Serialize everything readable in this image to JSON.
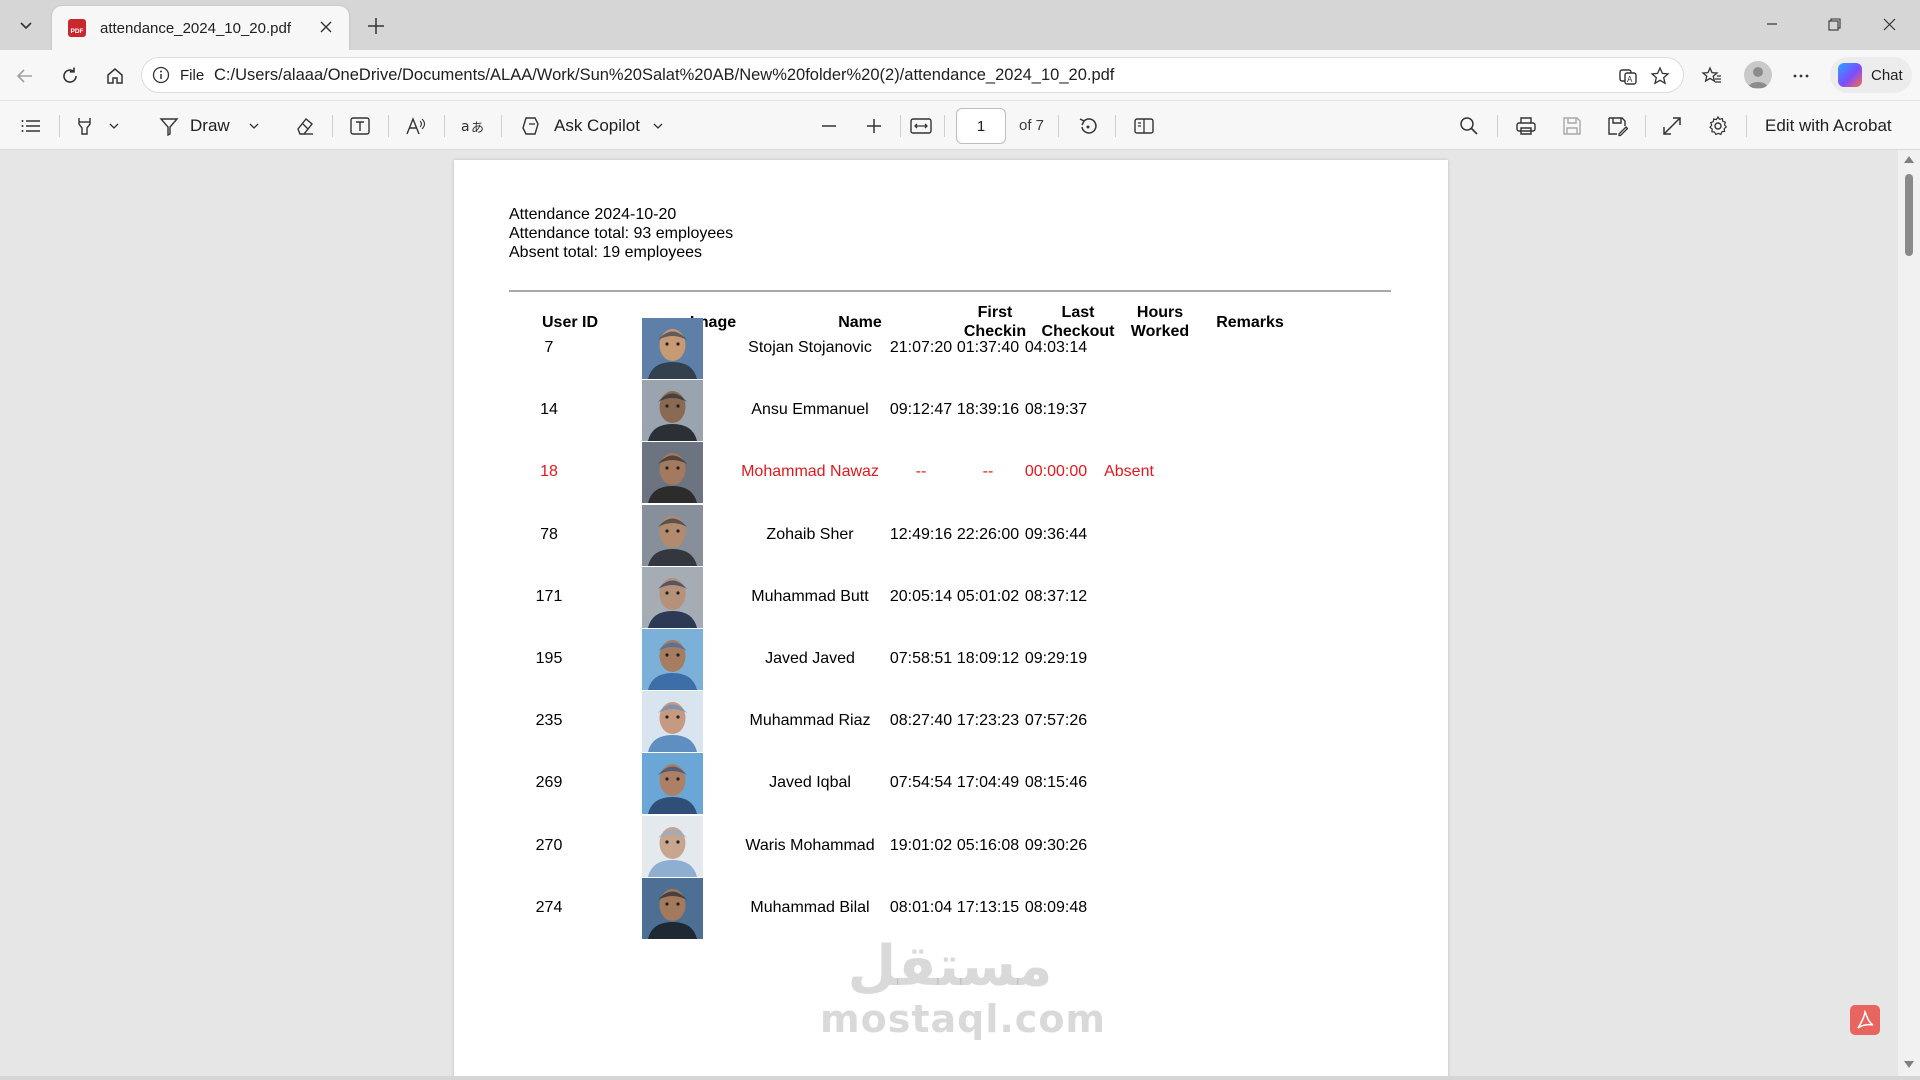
{
  "browser": {
    "tab_title": "attendance_2024_10_20.pdf",
    "pdf_badge": "PDF",
    "scheme_label": "File",
    "url": "C:/Users/alaaa/OneDrive/Documents/ALAA/Work/Sun%20Salat%20AB/New%20folder%20(2)/attendance_2024_10_20.pdf",
    "chat_label": "Chat"
  },
  "pdf_toolbar": {
    "draw_label": "Draw",
    "ask_copilot_label": "Ask Copilot",
    "page_current": "1",
    "page_total": "of 7",
    "edit_acrobat_label": "Edit with Acrobat"
  },
  "document": {
    "summary": {
      "title": "Attendance 2024-10-20",
      "attendance_total": "Attendance total: 93 employees",
      "absent_total": "Absent total: 19 employees"
    },
    "columns": {
      "user_id": "User ID",
      "image": "Image",
      "name": "Name",
      "first_checkin_1": "First",
      "first_checkin_2": "Checkin",
      "last_checkout_1": "Last",
      "last_checkout_2": "Checkout",
      "hours_worked_1": "Hours",
      "hours_worked_2": "Worked",
      "remarks": "Remarks"
    },
    "rows": [
      {
        "user_id": "7",
        "name": "Stojan Stojanovic",
        "first_checkin": "21:07:20",
        "last_checkout": "01:37:40",
        "hours_worked": "04:03:14",
        "remarks": ""
      },
      {
        "user_id": "14",
        "name": "Ansu Emmanuel",
        "first_checkin": "09:12:47",
        "last_checkout": "18:39:16",
        "hours_worked": "08:19:37",
        "remarks": ""
      },
      {
        "user_id": "18",
        "name": "Mohammad Nawaz",
        "first_checkin": "--",
        "last_checkout": "--",
        "hours_worked": "00:00:00",
        "remarks": "Absent"
      },
      {
        "user_id": "78",
        "name": "Zohaib Sher",
        "first_checkin": "12:49:16",
        "last_checkout": "22:26:00",
        "hours_worked": "09:36:44",
        "remarks": ""
      },
      {
        "user_id": "171",
        "name": "Muhammad Butt",
        "first_checkin": "20:05:14",
        "last_checkout": "05:01:02",
        "hours_worked": "08:37:12",
        "remarks": ""
      },
      {
        "user_id": "195",
        "name": "Javed Javed",
        "first_checkin": "07:58:51",
        "last_checkout": "18:09:12",
        "hours_worked": "09:29:19",
        "remarks": ""
      },
      {
        "user_id": "235",
        "name": "Muhammad Riaz",
        "first_checkin": "08:27:40",
        "last_checkout": "17:23:23",
        "hours_worked": "07:57:26",
        "remarks": ""
      },
      {
        "user_id": "269",
        "name": "Javed Iqbal",
        "first_checkin": "07:54:54",
        "last_checkout": "17:04:49",
        "hours_worked": "08:15:46",
        "remarks": ""
      },
      {
        "user_id": "270",
        "name": "Waris Mohammad",
        "first_checkin": "19:01:02",
        "last_checkout": "05:16:08",
        "hours_worked": "09:30:26",
        "remarks": ""
      },
      {
        "user_id": "274",
        "name": "Muhammad Bilal",
        "first_checkin": "08:01:04",
        "last_checkout": "17:13:15",
        "hours_worked": "08:09:48",
        "remarks": ""
      }
    ]
  },
  "watermark": {
    "arabic": "مستقل",
    "latin": "mostaql.com"
  },
  "colors": {
    "absent_text": "#e0191e",
    "page_background": "#ffffff",
    "viewer_background": "#e6e6e6"
  },
  "icons": [
    "tab-actions-icon",
    "pdf-file-icon",
    "close-icon",
    "plus-icon",
    "minimize-icon",
    "maximize-icon",
    "window-close-icon",
    "back-icon",
    "refresh-icon",
    "home-icon",
    "info-icon",
    "read-aloud-icon",
    "favorite-star-icon",
    "favorites-icon",
    "profile-icon",
    "more-icon",
    "copilot-icon",
    "contents-icon",
    "highlight-icon",
    "draw-icon",
    "eraser-icon",
    "text-box-icon",
    "read-aloud-a-icon",
    "translate-icon",
    "ask-copilot-icon",
    "zoom-out-icon",
    "zoom-in-icon",
    "fit-page-icon",
    "rotate-icon",
    "page-view-icon",
    "search-icon",
    "print-icon",
    "save-icon",
    "save-as-icon",
    "fullscreen-icon",
    "settings-icon",
    "acrobat-icon"
  ]
}
